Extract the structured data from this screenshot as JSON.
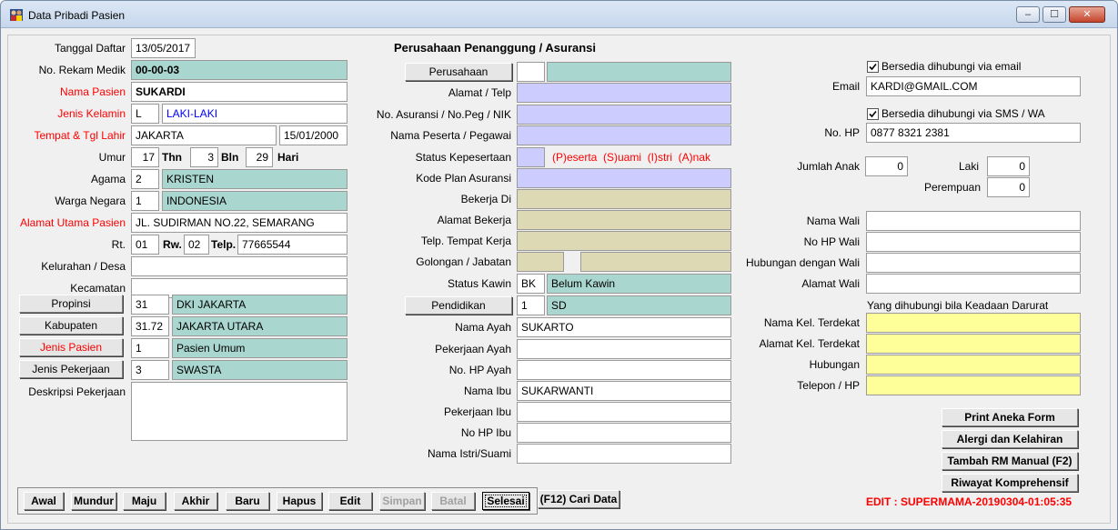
{
  "window": {
    "title": "Data Pribadi Pasien",
    "minimize": "‒",
    "maximize": "☐",
    "close": "✕"
  },
  "left": {
    "tanggal_daftar": {
      "label": "Tanggal Daftar",
      "value": "13/05/2017"
    },
    "no_rekam_medik": {
      "label": "No. Rekam Medik",
      "value": "00-00-03"
    },
    "nama_pasien": {
      "label": "Nama Pasien",
      "value": "SUKARDI"
    },
    "jenis_kelamin": {
      "label": "Jenis Kelamin",
      "code": "L",
      "value": "LAKI-LAKI"
    },
    "tempat_tgl_lahir": {
      "label": "Tempat & Tgl Lahir",
      "place": "JAKARTA",
      "date": "15/01/2000"
    },
    "umur": {
      "label": "Umur",
      "thn": "17",
      "thn_label": "Thn",
      "bln": "3",
      "bln_label": "Bln",
      "hari": "29",
      "hari_label": "Hari"
    },
    "agama": {
      "label": "Agama",
      "code": "2",
      "value": "KRISTEN"
    },
    "warga_negara": {
      "label": "Warga Negara",
      "code": "1",
      "value": "INDONESIA"
    },
    "alamat_utama": {
      "label": "Alamat Utama Pasien",
      "value": "JL. SUDIRMAN NO.22, SEMARANG"
    },
    "rt": {
      "label": "Rt.",
      "value": "01"
    },
    "rw": {
      "label": "Rw.",
      "value": "02"
    },
    "telp": {
      "label": "Telp.",
      "value": "77665544"
    },
    "kelurahan": {
      "label": "Kelurahan / Desa",
      "value": ""
    },
    "kecamatan": {
      "label": "Kecamatan",
      "value": ""
    },
    "propinsi": {
      "button": "Propinsi",
      "code": "31",
      "value": "DKI JAKARTA"
    },
    "kabupaten": {
      "button": "Kabupaten",
      "code": "31.72",
      "value": "JAKARTA UTARA"
    },
    "jenis_pasien": {
      "button": "Jenis Pasien",
      "code": "1",
      "value": "Pasien Umum"
    },
    "jenis_pekerjaan": {
      "button": "Jenis Pekerjaan",
      "code": "3",
      "value": "SWASTA"
    },
    "deskripsi_pekerjaan": {
      "label": "Deskripsi Pekerjaan",
      "value": ""
    }
  },
  "middle": {
    "section_title": "Perusahaan Penanggung / Asuransi",
    "perusahaan": {
      "button": "Perusahaan",
      "code": "",
      "value": ""
    },
    "alamat_telp": {
      "label": "Alamat / Telp",
      "value": ""
    },
    "no_asuransi": {
      "label": "No. Asuransi / No.Peg / NIK",
      "value": ""
    },
    "nama_peserta": {
      "label": "Nama Peserta / Pegawai",
      "value": ""
    },
    "status_kepesertaan": {
      "label": "Status Kepesertaan",
      "value": "",
      "hint": "(P)eserta  (S)uami  (I)stri  (A)nak"
    },
    "kode_plan": {
      "label": "Kode Plan Asuransi",
      "value": ""
    },
    "bekerja_di": {
      "label": "Bekerja Di",
      "value": ""
    },
    "alamat_bekerja": {
      "label": "Alamat  Bekerja",
      "value": ""
    },
    "telp_tempat_kerja": {
      "label": "Telp. Tempat Kerja",
      "value": ""
    },
    "golongan_jabatan": {
      "label": "Golongan / Jabatan",
      "gol": "",
      "jabatan": ""
    },
    "status_kawin": {
      "label": "Status Kawin",
      "code": "BK",
      "value": "Belum Kawin"
    },
    "pendidikan": {
      "button": "Pendidikan",
      "code": "1",
      "value": "SD"
    },
    "nama_ayah": {
      "label": "Nama Ayah",
      "value": "SUKARTO"
    },
    "pekerjaan_ayah": {
      "label": "Pekerjaan Ayah",
      "value": ""
    },
    "no_hp_ayah": {
      "label": "No. HP Ayah",
      "value": ""
    },
    "nama_ibu": {
      "label": "Nama Ibu",
      "value": "SUKARWANTI"
    },
    "pekerjaan_ibu": {
      "label": "Pekerjaan Ibu",
      "value": ""
    },
    "no_hp_ibu": {
      "label": "No HP Ibu",
      "value": ""
    },
    "nama_istri_suami": {
      "label": "Nama Istri/Suami",
      "value": ""
    }
  },
  "right": {
    "email_opt": {
      "label": "Bersedia dihubungi via email",
      "checked": true
    },
    "email": {
      "label": "Email",
      "value": "KARDI@GMAIL.COM"
    },
    "sms_opt": {
      "label": "Bersedia dihubungi via SMS / WA",
      "checked": true
    },
    "no_hp": {
      "label": "No. HP",
      "value": "0877 8321 2381"
    },
    "jumlah_anak": {
      "label": "Jumlah Anak",
      "value": "0"
    },
    "laki": {
      "label": "Laki",
      "value": "0"
    },
    "perempuan": {
      "label": "Perempuan",
      "value": "0"
    },
    "nama_wali": {
      "label": "Nama Wali",
      "value": ""
    },
    "no_hp_wali": {
      "label": "No HP Wali",
      "value": ""
    },
    "hubungan_wali": {
      "label": "Hubungan dengan Wali",
      "value": ""
    },
    "alamat_wali": {
      "label": "Alamat Wali",
      "value": ""
    },
    "darurat_title": "Yang dihubungi bila Keadaan Darurat",
    "nama_kel": {
      "label": "Nama Kel. Terdekat",
      "value": ""
    },
    "alamat_kel": {
      "label": "Alamat Kel. Terdekat",
      "value": ""
    },
    "hubungan": {
      "label": "Hubungan",
      "value": ""
    },
    "telepon_hp": {
      "label": "Telepon / HP",
      "value": ""
    },
    "buttons": {
      "print": "Print Aneka Form",
      "alergi": "Alergi dan Kelahiran",
      "tambah_rm": "Tambah RM Manual (F2)",
      "riwayat": "Riwayat Komprehensif"
    },
    "edit_status": "EDIT : SUPERMAMA-20190304-01:05:35"
  },
  "nav": {
    "awal": "Awal",
    "mundur": "Mundur",
    "maju": "Maju",
    "akhir": "Akhir",
    "baru": "Baru",
    "hapus": "Hapus",
    "edit": "Edit",
    "simpan": "Simpan",
    "batal": "Batal",
    "selesai": "Selesai",
    "cari": "(F12) Cari Data"
  },
  "colors": {
    "teal": "#a9d6cf",
    "lavender": "#ccccff",
    "khaki": "#dcd9b4",
    "yellow": "#ffff99",
    "red_label": "#ff0000"
  }
}
